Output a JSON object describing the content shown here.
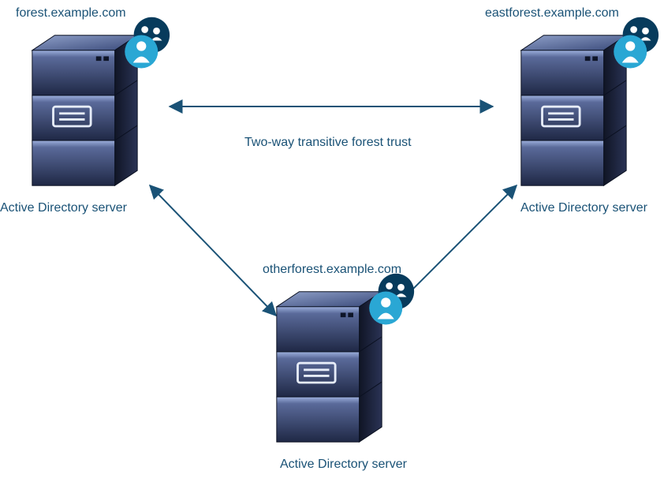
{
  "nodes": {
    "left": {
      "domain": "forest.example.com",
      "caption": "Active Directory server"
    },
    "right": {
      "domain": "eastforest.example.com",
      "caption": "Active Directory server"
    },
    "bottom": {
      "domain": "otherforest.example.com",
      "caption": "Active Directory server"
    }
  },
  "center_label": "Two-way transitive forest trust",
  "colors": {
    "text": "#1a5276",
    "arrow": "#1a5276",
    "badge_dark": "#073b5c",
    "badge_light": "#2aa7d4",
    "server_light": "#5a6a9a",
    "server_dark": "#1a2238"
  }
}
